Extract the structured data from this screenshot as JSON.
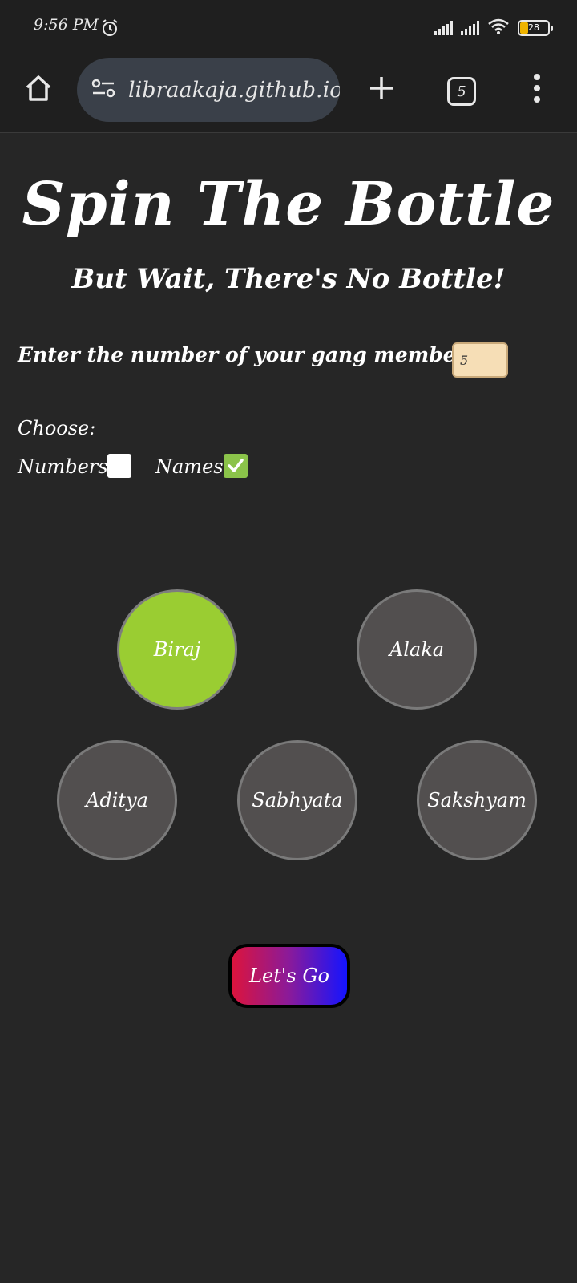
{
  "status_bar": {
    "time": "9:56 PM",
    "battery_level": "28"
  },
  "browser": {
    "url": "libraakaja.github.io/:",
    "tab_count": "5"
  },
  "page": {
    "title": "Spin The Bottle",
    "subtitle": "But Wait, There's No Bottle!",
    "members_label": "Enter the number of your gang members:",
    "members_value": "5",
    "choose_label": "Choose:",
    "options": {
      "numbers_label": "Numbers",
      "numbers_checked": false,
      "names_label": "Names",
      "names_checked": true
    },
    "members": [
      "Biraj",
      "Alaka",
      "Aditya",
      "Sabhyata",
      "Sakshyam"
    ],
    "selected_member": "Biraj",
    "go_button": "Let's Go"
  },
  "colors": {
    "background": "#262626",
    "selected_circle": "#9acd32",
    "circle": "#524f4f",
    "input_bg": "#f6deb6",
    "checkbox_checked": "#8bc34a",
    "button_gradient_start": "#dc143c",
    "button_gradient_end": "#1414ff"
  }
}
